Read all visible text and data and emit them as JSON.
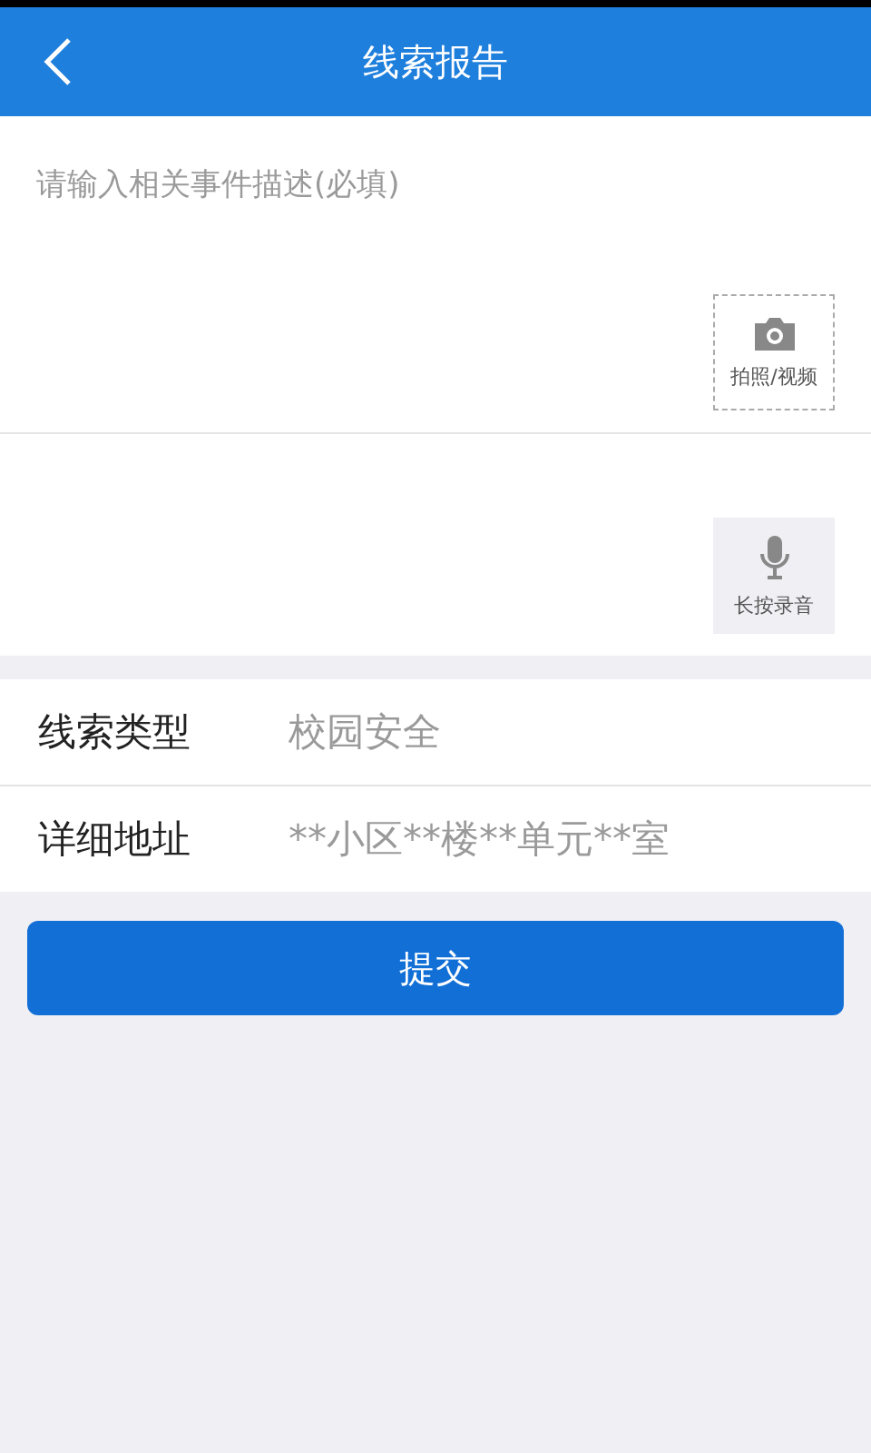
{
  "header": {
    "title": "线索报告"
  },
  "description": {
    "placeholder": "请输入相关事件描述(必填)"
  },
  "media": [
    {
      "kind": "camera",
      "label": "拍照/视频"
    },
    {
      "kind": "mic",
      "label": "长按录音"
    }
  ],
  "fields": [
    {
      "label": "线索类型",
      "placeholder": "校园安全"
    },
    {
      "label": "详细地址",
      "placeholder": "**小区**楼**单元**室"
    }
  ],
  "submit": "提交"
}
